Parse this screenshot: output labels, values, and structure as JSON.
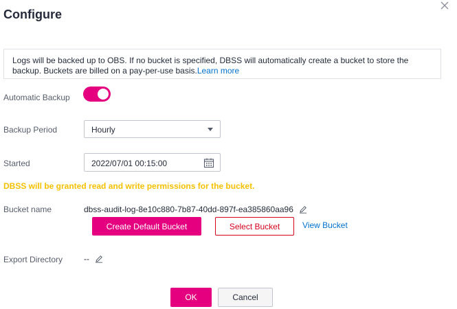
{
  "dialog": {
    "title": "Configure",
    "close_icon": "close-icon"
  },
  "info": {
    "text": "Logs will be backed up to OBS. If no bucket is specified, DBSS will automatically create a bucket to store the backup. Buckets are billed on a pay-per-use basis.",
    "link": "Learn more"
  },
  "automatic_backup": {
    "label": "Automatic Backup",
    "enabled": true,
    "accent_color": "#e4007f"
  },
  "backup_period": {
    "label": "Backup Period",
    "value": "Hourly"
  },
  "started": {
    "label": "Started",
    "value": "2022/07/01 00:15:00",
    "icon": "calendar-icon"
  },
  "warning": {
    "text": "DBSS will be granted read and write permissions for the bucket.",
    "color": "#f5c000"
  },
  "bucket": {
    "label": "Bucket name",
    "value": "dbss-audit-log-8e10c880-7b87-40dd-897f-ea385860aa96",
    "create_default_label": "Create Default Bucket",
    "select_label": "Select Bucket",
    "view_label": "View Bucket"
  },
  "export_directory": {
    "label": "Export Directory",
    "value": "--"
  },
  "footer": {
    "ok_label": "OK",
    "cancel_label": "Cancel"
  }
}
